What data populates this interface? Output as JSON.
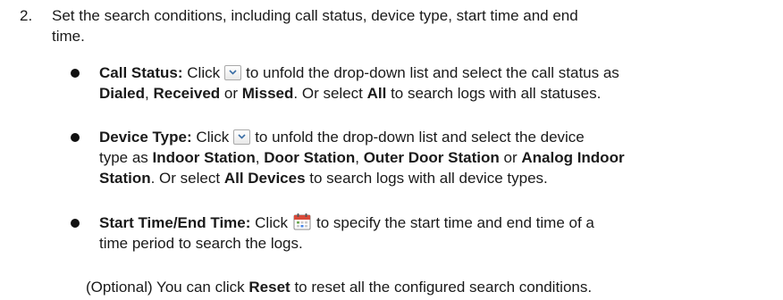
{
  "step": {
    "number": "2.",
    "line1": "Set the search conditions, including call status, device type, start time and end",
    "line2": "time."
  },
  "call_status": {
    "label": "Call Status:",
    "t1": "Click",
    "t2": "to unfold the drop-down list and select the call status as",
    "opt1": "Dialed",
    "t3": ",",
    "opt2": "Received",
    "t4": "or",
    "opt3": "Missed",
    "t5": ". Or select",
    "opt4": "All",
    "t6": "to search logs with all statuses."
  },
  "device_type": {
    "label": "Device Type:",
    "t1": "Click",
    "t2": "to unfold the drop-down list and select the device",
    "t3": "type as",
    "opt1": "Indoor Station",
    "t4": ",",
    "opt2": "Door Station",
    "t5": ",",
    "opt3": "Outer Door Station",
    "t6": "or",
    "opt4": "Analog Indoor",
    "opt4b": "Station",
    "t7": ". Or select",
    "opt5": "All Devices",
    "t8": "to search logs with all device types."
  },
  "time": {
    "label": "Start Time/End Time:",
    "t1": "Click",
    "t2": "to specify the start time and end time of a",
    "t3": "time period to search the logs."
  },
  "optional": {
    "t1": "(Optional) You can click",
    "btn": "Reset",
    "t2": "to reset all the configured search conditions."
  },
  "icons": {
    "dropdown": "dropdown-arrow-icon",
    "calendar": "calendar-icon"
  }
}
